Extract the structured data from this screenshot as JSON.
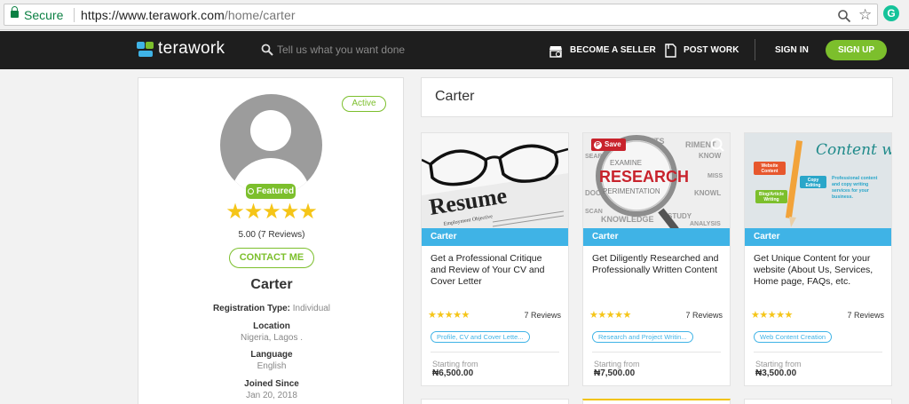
{
  "browser": {
    "secure_label": "Secure",
    "url_main": "https://www.terawork.com",
    "url_path": "/home/carter",
    "extension_letter": "G"
  },
  "header": {
    "logo_text": "terawork",
    "search_placeholder": "Tell us what you want done",
    "become_seller": "BECOME A SELLER",
    "post_work": "POST WORK",
    "sign_in": "SIGN IN",
    "sign_up": "SIGN UP"
  },
  "profile": {
    "status": "Active",
    "featured": "Featured",
    "stars": "★★★★★",
    "rating_text": "5.00 (7 Reviews)",
    "contact_label": "CONTACT ME",
    "name": "Carter",
    "registration_label": "Registration Type:",
    "registration_value": "Individual",
    "location_label": "Location",
    "location_value": "Nigeria, Lagos .",
    "language_label": "Language",
    "language_value": "English",
    "joined_label": "Joined Since",
    "joined_value": "Jan 20, 2018"
  },
  "page_title": "Carter",
  "gigs": [
    {
      "seller": "Carter",
      "title": "Get a Professional Critique and Review of Your CV and Cover Letter",
      "stars": "★★★★★",
      "reviews": "7 Reviews",
      "tag": "Profile, CV and Cover Lette...",
      "starting_label": "Starting from",
      "price": "₦6,500.00",
      "image_text": "Resume",
      "image_subtext": "Employment Objective"
    },
    {
      "seller": "Carter",
      "title": "Get Diligently Researched and Professionally Written Content",
      "stars": "★★★★★",
      "reviews": "7 Reviews",
      "tag": "Research and Project Writin...",
      "starting_label": "Starting from",
      "price": "₦7,500.00",
      "image_text": "RESEARCH",
      "save_label": "Save"
    },
    {
      "seller": "Carter",
      "title": "Get Unique Content for your website (About Us, Services, Home page, FAQs, etc.",
      "stars": "★★★★★",
      "reviews": "7 Reviews",
      "tag": "Web Content Creation",
      "starting_label": "Starting from",
      "price": "₦3,500.00",
      "image_text": "Content writing....",
      "image_labels": [
        "Website Content",
        "Copy Editing",
        "Blog/Article Writing"
      ],
      "image_caption": "Professional content and copy writing services for your business."
    }
  ],
  "colors": {
    "accent_green": "#7cbf2c",
    "accent_blue": "#3fb3e6",
    "star_gold": "#f5c518",
    "header_bg": "#1e1e1e"
  }
}
